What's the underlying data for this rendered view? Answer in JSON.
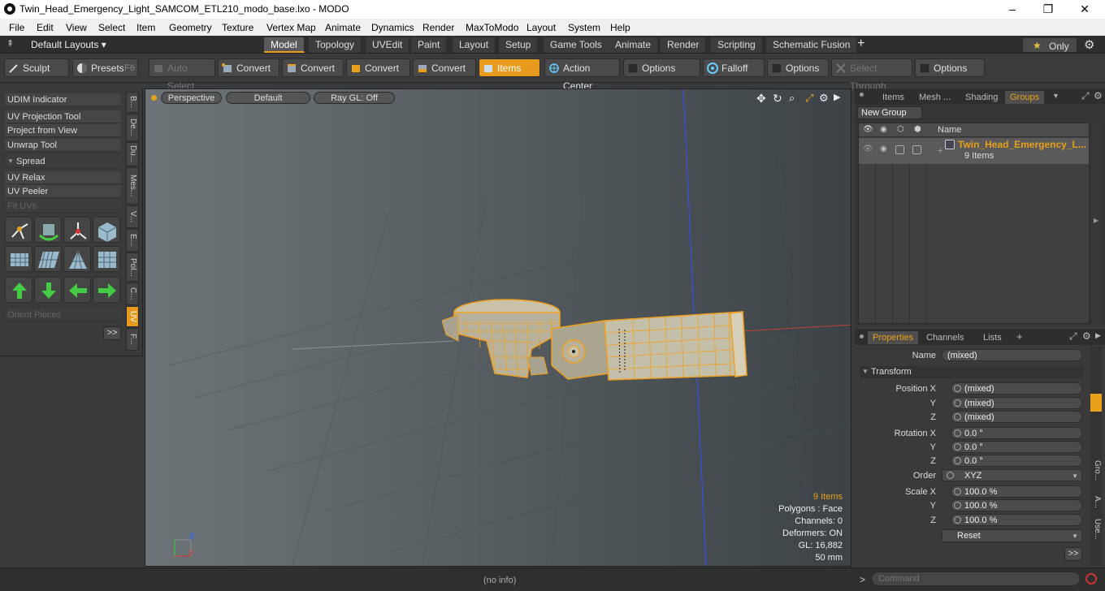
{
  "window": {
    "title": "Twin_Head_Emergency_Light_SAMCOM_ETL210_modo_base.lxo - MODO",
    "minimize": "–",
    "maximize": "❐",
    "close": "✕"
  },
  "menu": [
    "File",
    "Edit",
    "View",
    "Select",
    "Item",
    "Geometry",
    "Texture",
    "Vertex Map",
    "Animate",
    "Dynamics",
    "Render",
    "MaxToModo",
    "Layout",
    "System",
    "Help"
  ],
  "layouts": {
    "default_label": "Default Layouts ▾",
    "tabs": [
      "Model",
      "Topology",
      "UVEdit",
      "Paint",
      "Layout",
      "Setup",
      "Game Tools",
      "Animate",
      "Render",
      "Scripting",
      "Schematic Fusion"
    ],
    "active_tab": "Model",
    "add": "+",
    "only_label": "Only"
  },
  "toolbar": {
    "sculpt": "Sculpt",
    "presets": "Presets",
    "presets_key": "F6",
    "auto_select": "Auto Select",
    "convert1": "Convert",
    "convert2": "Convert",
    "convert3": "Convert",
    "convert4": "Convert",
    "items": "Items",
    "action_center": "Action Center",
    "options1": "Options",
    "falloff": "Falloff",
    "options2": "Options",
    "select_through": "Select Through",
    "options3": "Options"
  },
  "leftpanel": {
    "udim": "UDIM Indicator",
    "uv_projection": "UV Projection Tool",
    "project_from_view": "Project from View",
    "unwrap": "Unwrap Tool",
    "spread": "Spread",
    "uv_relax": "UV Relax",
    "uv_peeler": "UV Peeler",
    "fit_uvs": "Fit UVs",
    "orient_pieces": "Orient Pieces",
    "more": ">>",
    "vtabs": [
      "B...",
      "De...",
      "Du...",
      "Mes...",
      "V...",
      "E...",
      "Pol...",
      "C...",
      "UV",
      "F..."
    ]
  },
  "viewport": {
    "perspective": "Perspective",
    "default": "Default",
    "raygl": "Ray GL: Off",
    "stats": {
      "items": "9 Items",
      "polygons": "Polygons : Face",
      "channels": "Channels: 0",
      "deformers": "Deformers: ON",
      "gl": "GL: 16,882",
      "mm": "50 mm"
    }
  },
  "groups_panel": {
    "tabs": [
      "Items",
      "Mesh ...",
      "Shading",
      "Groups"
    ],
    "active": "Groups",
    "new_group": "New Group",
    "col_name": "Name",
    "row_name": "Twin_Head_Emergency_L...",
    "row_sub": "9 Items"
  },
  "properties": {
    "tabs": [
      "Properties",
      "Channels",
      "Lists"
    ],
    "add": "+",
    "name_label": "Name",
    "name_value": "(mixed)",
    "transform": "Transform",
    "rows": [
      {
        "label": "Position X",
        "value": "(mixed)"
      },
      {
        "label": "Y",
        "value": "(mixed)"
      },
      {
        "label": "Z",
        "value": "(mixed)"
      },
      {
        "label": "Rotation X",
        "value": "0.0 °"
      },
      {
        "label": "Y",
        "value": "0.0 °"
      },
      {
        "label": "Z",
        "value": "0.0 °"
      },
      {
        "label": "Order",
        "value": "XYZ"
      },
      {
        "label": "Scale X",
        "value": "100.0 %"
      },
      {
        "label": "Y",
        "value": "100.0 %"
      },
      {
        "label": "Z",
        "value": "100.0 %"
      }
    ],
    "reset": "Reset",
    "more": ">>",
    "side_tabs": [
      "Gro...",
      "A...",
      "Use..."
    ]
  },
  "status": {
    "info": "(no info)",
    "command_placeholder": "Command",
    "prompt": ">"
  },
  "colors": {
    "accent": "#e8a01a",
    "wire": "#f0a020"
  }
}
